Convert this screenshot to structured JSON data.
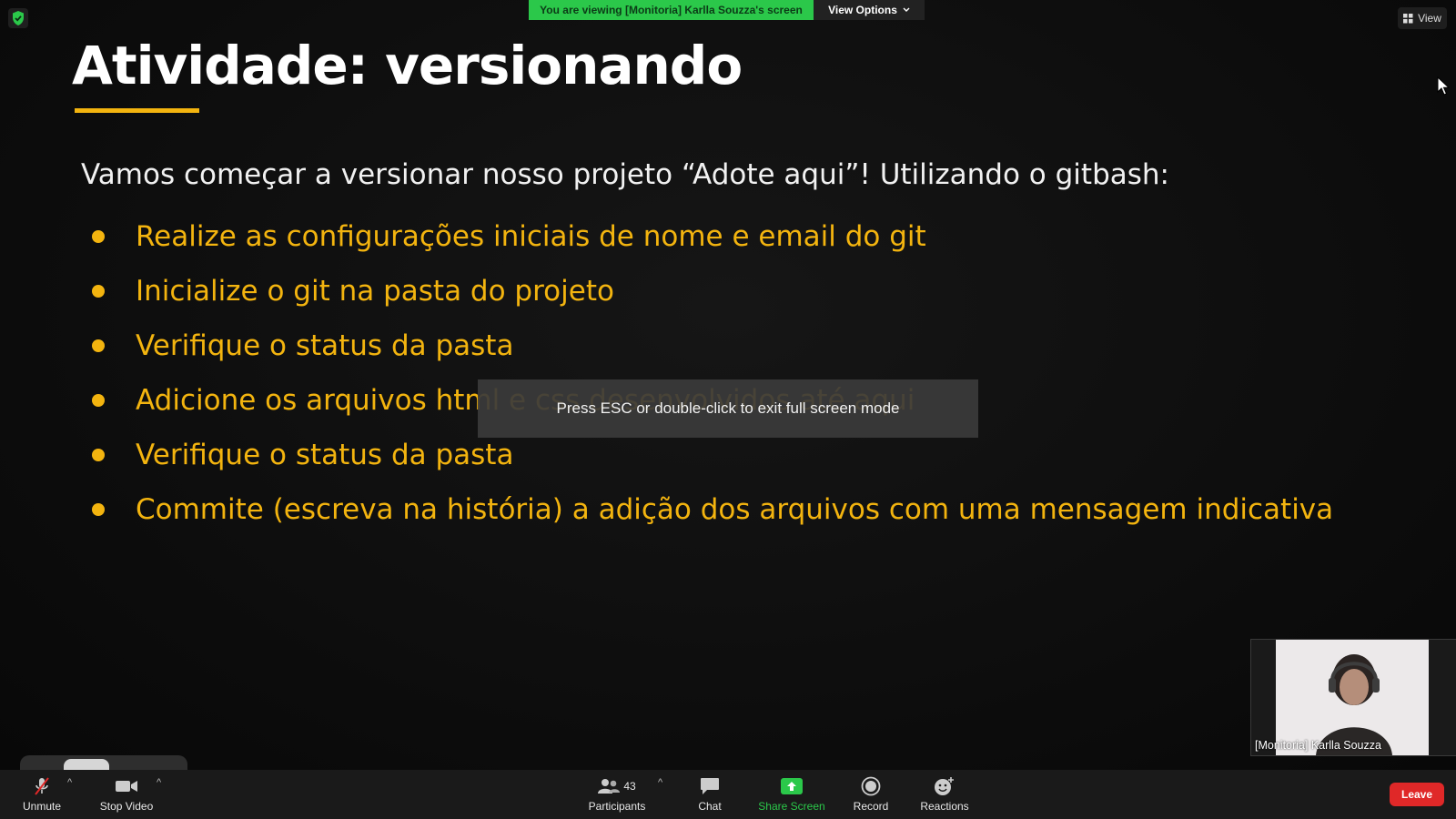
{
  "banner": {
    "viewing_text": "You are viewing [Monitoria] Karlla Souzza's screen",
    "view_options_label": "View Options"
  },
  "view_button_label": "View",
  "slide": {
    "title": "Atividade: versionando",
    "intro": "Vamos começar a versionar nosso projeto “Adote aqui”! Utilizando o gitbash:",
    "bullets": [
      "Realize as configurações iniciais de nome e email do git",
      "Inicialize o git na pasta do projeto",
      "Verifique o status da pasta",
      "Adicione os arquivos html e css desenvolvidos até aqui",
      "Verifique o status da pasta",
      "Commite (escreva na história) a adição dos arquivos com uma mensagem indicativa"
    ],
    "accent_color": "#f3b40f"
  },
  "fullscreen_toast": "Press ESC or double-click to exit full screen mode",
  "self_view": {
    "name": "[Monitoria] Karlla Souzza"
  },
  "toolbar": {
    "unmute_label": "Unmute",
    "stop_video_label": "Stop Video",
    "participants_label": "Participants",
    "participants_count": "43",
    "chat_label": "Chat",
    "share_screen_label": "Share Screen",
    "record_label": "Record",
    "reactions_label": "Reactions",
    "leave_label": "Leave"
  },
  "icons": [
    "shield-icon",
    "chevron-down-icon",
    "view-grid-icon",
    "mouse-cursor-icon",
    "microphone-muted-icon",
    "video-camera-icon",
    "participants-icon",
    "chat-icon",
    "share-screen-icon",
    "record-icon",
    "reactions-icon"
  ],
  "colors": {
    "share_green": "#2bc84a",
    "leave_red": "#e02828",
    "banner_green": "#2bc84a"
  }
}
